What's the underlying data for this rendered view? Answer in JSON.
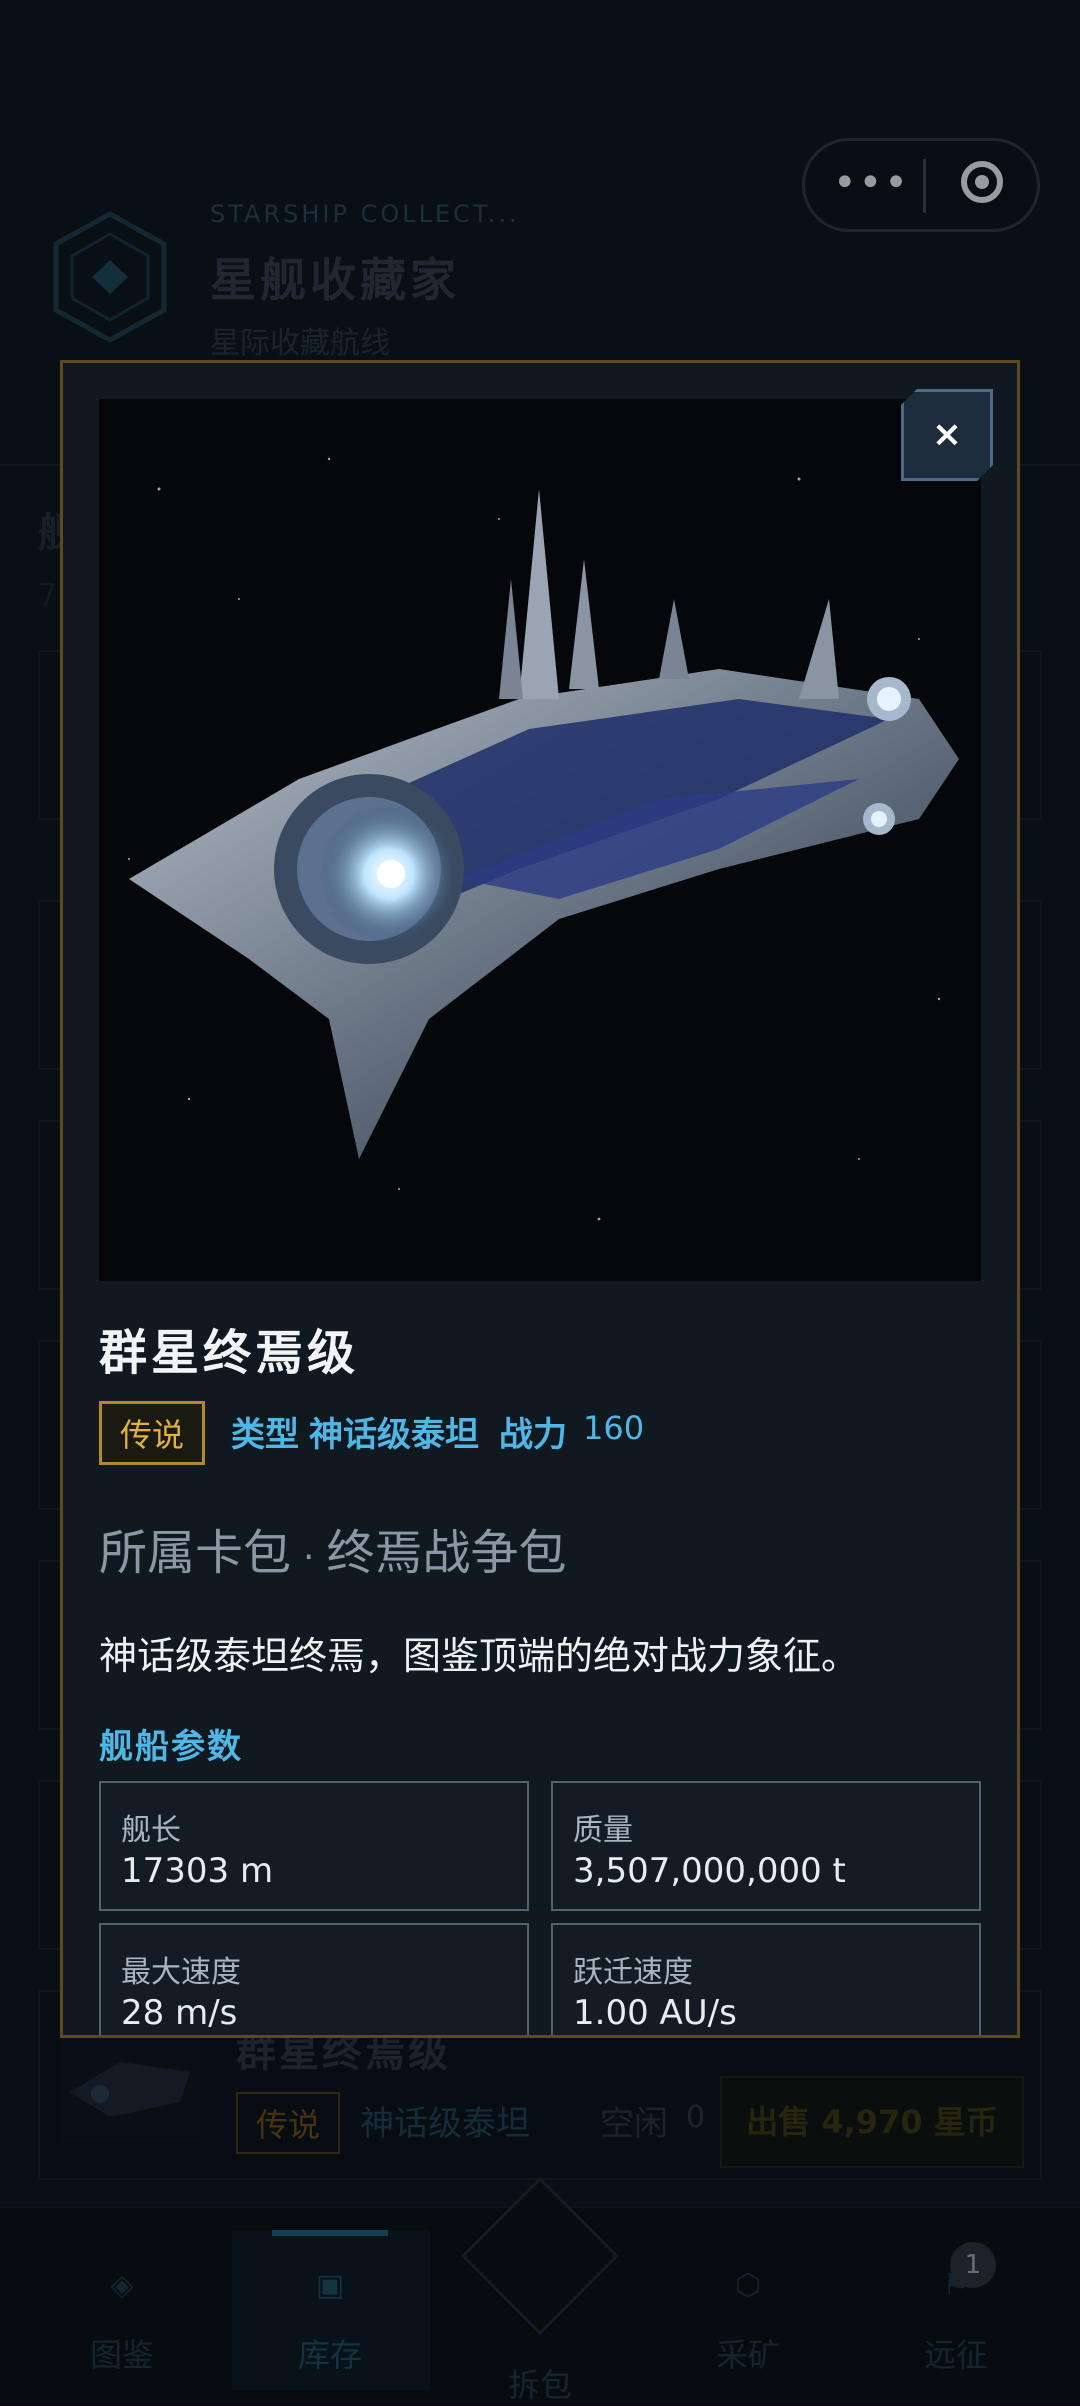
{
  "capsule": {
    "more_icon": "more-dots-icon",
    "close_icon": "target-icon"
  },
  "app": {
    "subtitle_en": "STARSHIP COLLECT...",
    "title": "星舰收藏家",
    "subtitle": "星际收藏航线",
    "bg_left_fragment": "舰",
    "bg_left_fragment2": "7"
  },
  "list_item": {
    "name": "群星终焉级",
    "rarity": "传说",
    "type": "神话级泰坦",
    "status": "空闲",
    "count": "0",
    "sell_label": "出售 4,970 星币"
  },
  "nav": {
    "items": [
      {
        "label": "图鉴",
        "icon": "diamond-icon"
      },
      {
        "label": "库存",
        "icon": "square-icon"
      },
      {
        "label": "拆包",
        "icon": "star-icon"
      },
      {
        "label": "采矿",
        "icon": "hexagon-icon"
      },
      {
        "label": "远征",
        "icon": "flag-icon"
      }
    ],
    "active": "库存",
    "badge": "1"
  },
  "modal": {
    "close_label": "×",
    "ship_name": "群星终焉级",
    "rarity": "传说",
    "type_label": "类型",
    "type_value": "神话级泰坦",
    "power_label": "战力",
    "power_value": "160",
    "pack_label": "所属卡包",
    "pack_separator": "·",
    "pack_value": "终焉战争包",
    "description": "神话级泰坦终焉，图鉴顶端的绝对战力象征。",
    "params_title": "舰船参数",
    "params": [
      {
        "label": "舰长",
        "value": "17303 m"
      },
      {
        "label": "质量",
        "value": "3,507,000,000 t"
      },
      {
        "label": "最大速度",
        "value": "28 m/s"
      },
      {
        "label": "跃迁速度",
        "value": "1.00 AU/s"
      }
    ]
  },
  "colors": {
    "accent": "#4fb7e6",
    "gold": "#e0b040",
    "modal_border": "#5e4a1a"
  }
}
